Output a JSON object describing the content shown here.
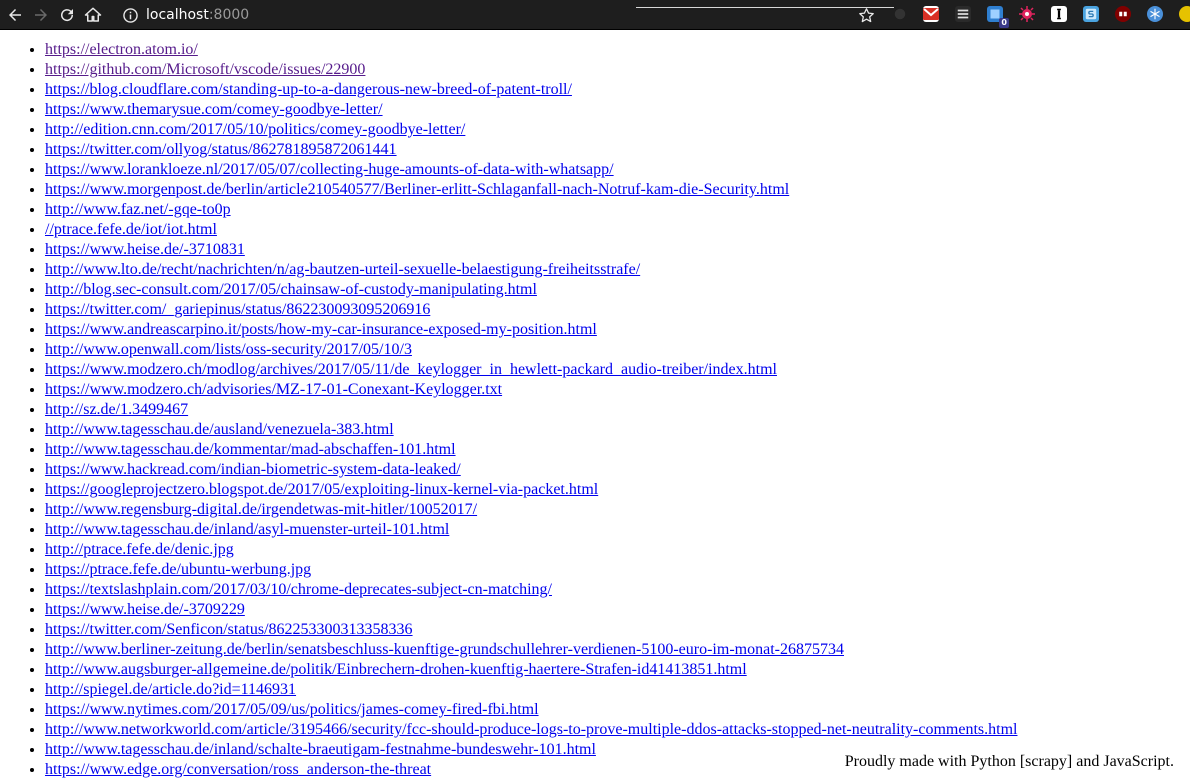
{
  "browser": {
    "url_host": "localhost",
    "url_port": ":8000",
    "ext_badge": "0",
    "colors": {
      "toolbar_bg": "#1e1e1e",
      "link": "#0000ee",
      "link_visited": "#551a8b"
    }
  },
  "links": [
    {
      "href": "https://electron.atom.io/",
      "visited": true
    },
    {
      "href": "https://github.com/Microsoft/vscode/issues/22900",
      "visited": true
    },
    {
      "href": "https://blog.cloudflare.com/standing-up-to-a-dangerous-new-breed-of-patent-troll/",
      "visited": false
    },
    {
      "href": "https://www.themarysue.com/comey-goodbye-letter/",
      "visited": false
    },
    {
      "href": "http://edition.cnn.com/2017/05/10/politics/comey-goodbye-letter/",
      "visited": false
    },
    {
      "href": "https://twitter.com/ollyog/status/862781895872061441",
      "visited": false
    },
    {
      "href": "https://www.lorankloeze.nl/2017/05/07/collecting-huge-amounts-of-data-with-whatsapp/",
      "visited": false
    },
    {
      "href": "https://www.morgenpost.de/berlin/article210540577/Berliner-erlitt-Schlaganfall-nach-Notruf-kam-die-Security.html",
      "visited": false
    },
    {
      "href": "http://www.faz.net/-gqe-to0p",
      "visited": false
    },
    {
      "href": "//ptrace.fefe.de/iot/iot.html",
      "visited": false
    },
    {
      "href": "https://www.heise.de/-3710831",
      "visited": false
    },
    {
      "href": "http://www.lto.de/recht/nachrichten/n/ag-bautzen-urteil-sexuelle-belaestigung-freiheitsstrafe/",
      "visited": false
    },
    {
      "href": "http://blog.sec-consult.com/2017/05/chainsaw-of-custody-manipulating.html",
      "visited": false
    },
    {
      "href": "https://twitter.com/_gariepinus/status/862230093095206916",
      "visited": false
    },
    {
      "href": "https://www.andreascarpino.it/posts/how-my-car-insurance-exposed-my-position.html",
      "visited": false
    },
    {
      "href": "http://www.openwall.com/lists/oss-security/2017/05/10/3",
      "visited": false
    },
    {
      "href": "https://www.modzero.ch/modlog/archives/2017/05/11/de_keylogger_in_hewlett-packard_audio-treiber/index.html",
      "visited": false
    },
    {
      "href": "https://www.modzero.ch/advisories/MZ-17-01-Conexant-Keylogger.txt",
      "visited": false
    },
    {
      "href": "http://sz.de/1.3499467",
      "visited": false
    },
    {
      "href": "http://www.tagesschau.de/ausland/venezuela-383.html",
      "visited": false
    },
    {
      "href": "http://www.tagesschau.de/kommentar/mad-abschaffen-101.html",
      "visited": false
    },
    {
      "href": "https://www.hackread.com/indian-biometric-system-data-leaked/",
      "visited": false
    },
    {
      "href": "https://googleprojectzero.blogspot.de/2017/05/exploiting-linux-kernel-via-packet.html",
      "visited": false
    },
    {
      "href": "http://www.regensburg-digital.de/irgendetwas-mit-hitler/10052017/",
      "visited": false
    },
    {
      "href": "http://www.tagesschau.de/inland/asyl-muenster-urteil-101.html",
      "visited": false
    },
    {
      "href": "http://ptrace.fefe.de/denic.jpg",
      "visited": false
    },
    {
      "href": "https://ptrace.fefe.de/ubuntu-werbung.jpg",
      "visited": false
    },
    {
      "href": "https://textslashplain.com/2017/03/10/chrome-deprecates-subject-cn-matching/",
      "visited": false
    },
    {
      "href": "https://www.heise.de/-3709229",
      "visited": false
    },
    {
      "href": "https://twitter.com/Senficon/status/862253300313358336",
      "visited": false
    },
    {
      "href": "http://www.berliner-zeitung.de/berlin/senatsbeschluss-kuenftige-grundschullehrer-verdienen-5100-euro-im-monat-26875734",
      "visited": false
    },
    {
      "href": "http://www.augsburger-allgemeine.de/politik/Einbrechern-drohen-kuenftig-haertere-Strafen-id41413851.html",
      "visited": false
    },
    {
      "href": "http://spiegel.de/article.do?id=1146931",
      "visited": false
    },
    {
      "href": "https://www.nytimes.com/2017/05/09/us/politics/james-comey-fired-fbi.html",
      "visited": false
    },
    {
      "href": "http://www.networkworld.com/article/3195466/security/fcc-should-produce-logs-to-prove-multiple-ddos-attacks-stopped-net-neutrality-comments.html",
      "visited": false
    },
    {
      "href": "http://www.tagesschau.de/inland/schalte-braeutigam-festnahme-bundeswehr-101.html",
      "visited": false
    },
    {
      "href": "https://www.edge.org/conversation/ross_anderson-the-threat",
      "visited": false
    }
  ],
  "footer": {
    "text": "Proudly made with Python [scrapy] and JavaScript."
  }
}
